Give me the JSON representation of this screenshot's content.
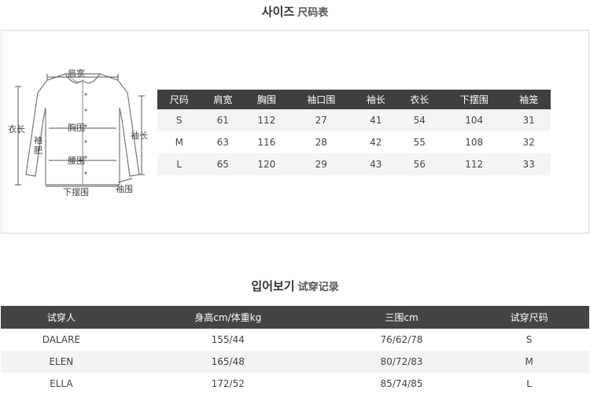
{
  "size_section": {
    "title_ko": "사이즈",
    "title_zh": "尺码表",
    "diagram_labels": {
      "shoulder": "肩宽",
      "length": "衣长",
      "chest": "胸围",
      "sleeve": "袖长",
      "armhole_line1": "袖",
      "armhole_line2": "肥",
      "waist": "腰围",
      "hem": "下摆围",
      "cuff": "袖围"
    },
    "headers": [
      "尺码",
      "肩宽",
      "胸围",
      "袖口围",
      "袖长",
      "衣长",
      "下摆围",
      "袖笼"
    ],
    "rows": [
      [
        "S",
        "61",
        "112",
        "27",
        "41",
        "54",
        "104",
        "31"
      ],
      [
        "M",
        "63",
        "116",
        "28",
        "42",
        "55",
        "108",
        "32"
      ],
      [
        "L",
        "65",
        "120",
        "29",
        "43",
        "56",
        "112",
        "33"
      ]
    ]
  },
  "fit_section": {
    "title_ko": "입어보기",
    "title_zh": "试穿记录",
    "headers": [
      "试穿人",
      "身高cm/体重kg",
      "三围cm",
      "试穿尺码"
    ],
    "rows": [
      [
        "DALARE",
        "155/44",
        "76/62/78",
        "S"
      ],
      [
        "ELEN",
        "165/48",
        "80/72/83",
        "M"
      ],
      [
        "ELLA",
        "172/52",
        "85/74/85",
        "L"
      ]
    ]
  }
}
